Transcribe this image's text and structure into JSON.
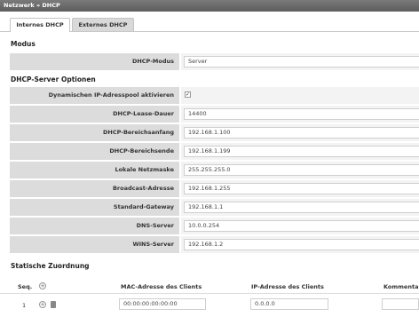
{
  "breadcrumb": "Netzwerk » DHCP",
  "tabs": [
    "Internes DHCP",
    "Externes DHCP"
  ],
  "modus": {
    "heading": "Modus",
    "label": "DHCP-Modus",
    "value": "Server"
  },
  "server": {
    "heading": "DHCP-Server Optionen",
    "pool": {
      "label": "Dynamischen IP-Adresspool aktivieren",
      "checked": true,
      "mark": "✓"
    },
    "rows": [
      {
        "label": "DHCP-Lease-Dauer",
        "value": "14400"
      },
      {
        "label": "DHCP-Bereichsanfang",
        "value": "192.168.1.100"
      },
      {
        "label": "DHCP-Bereichsende",
        "value": "192.168.1.199"
      },
      {
        "label": "Lokale Netzmaske",
        "value": "255.255.255.0"
      },
      {
        "label": "Broadcast-Adresse",
        "value": "192.168.1.255"
      },
      {
        "label": "Standard-Gateway",
        "value": "192.168.1.1"
      },
      {
        "label": "DNS-Server",
        "value": "10.0.0.254"
      },
      {
        "label": "WINS-Server",
        "value": "192.168.1.2"
      }
    ]
  },
  "static": {
    "heading": "Statische Zuordnung",
    "columns": {
      "seq": "Seq.",
      "mac": "MAC-Adresse des Clients",
      "ip": "IP-Adresse des Clients",
      "comment": "Kommentar"
    },
    "add_symbol": "+",
    "row": {
      "seq": "1",
      "mac": "00:00:00:00:00:00",
      "ip": "0.0.0.0",
      "comment": ""
    }
  }
}
